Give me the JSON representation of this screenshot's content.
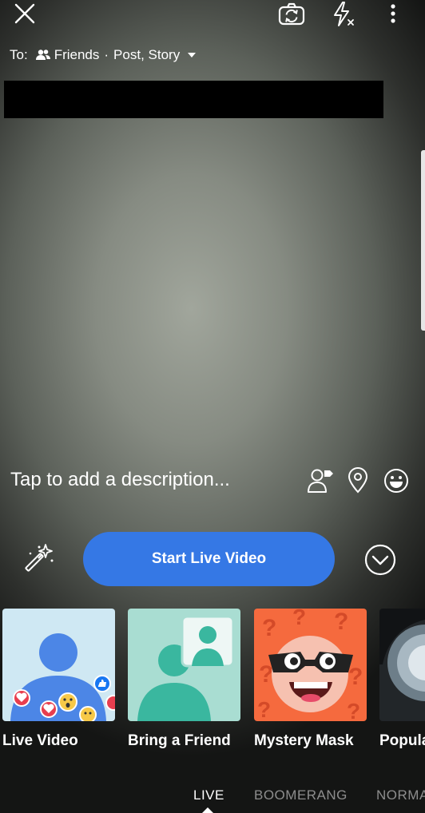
{
  "top_bar": {
    "close_icon": "close-icon",
    "flip_icon": "camera-flip-icon",
    "flash_icon": "flash-off-icon",
    "more_icon": "more-vertical-icon"
  },
  "audience": {
    "to_label": "To:",
    "audience_icon": "friends-icon",
    "audience_value": "Friends",
    "separator": "·",
    "destinations": "Post, Story",
    "dropdown_icon": "caret-down-icon"
  },
  "composer": {
    "description_placeholder": "Tap to add a description...",
    "tag_icon": "tag-people-icon",
    "location_icon": "location-pin-icon",
    "feeling_icon": "smiley-icon"
  },
  "actions": {
    "effects_icon": "magic-wand-icon",
    "start_live_label": "Start Live Video",
    "expand_icon": "chevron-down-circle-icon"
  },
  "effects_tray": {
    "items": [
      {
        "label": "Live Video"
      },
      {
        "label": "Bring a Friend"
      },
      {
        "label": "Mystery Mask"
      },
      {
        "label": "Popula"
      }
    ]
  },
  "modes": {
    "items": [
      {
        "label": "LIVE"
      },
      {
        "label": "BOOMERANG"
      },
      {
        "label": "NORMA"
      }
    ],
    "active": "LIVE"
  },
  "colors": {
    "primary_button": "#3578e5",
    "inactive_mode": "#8d8d8d"
  }
}
